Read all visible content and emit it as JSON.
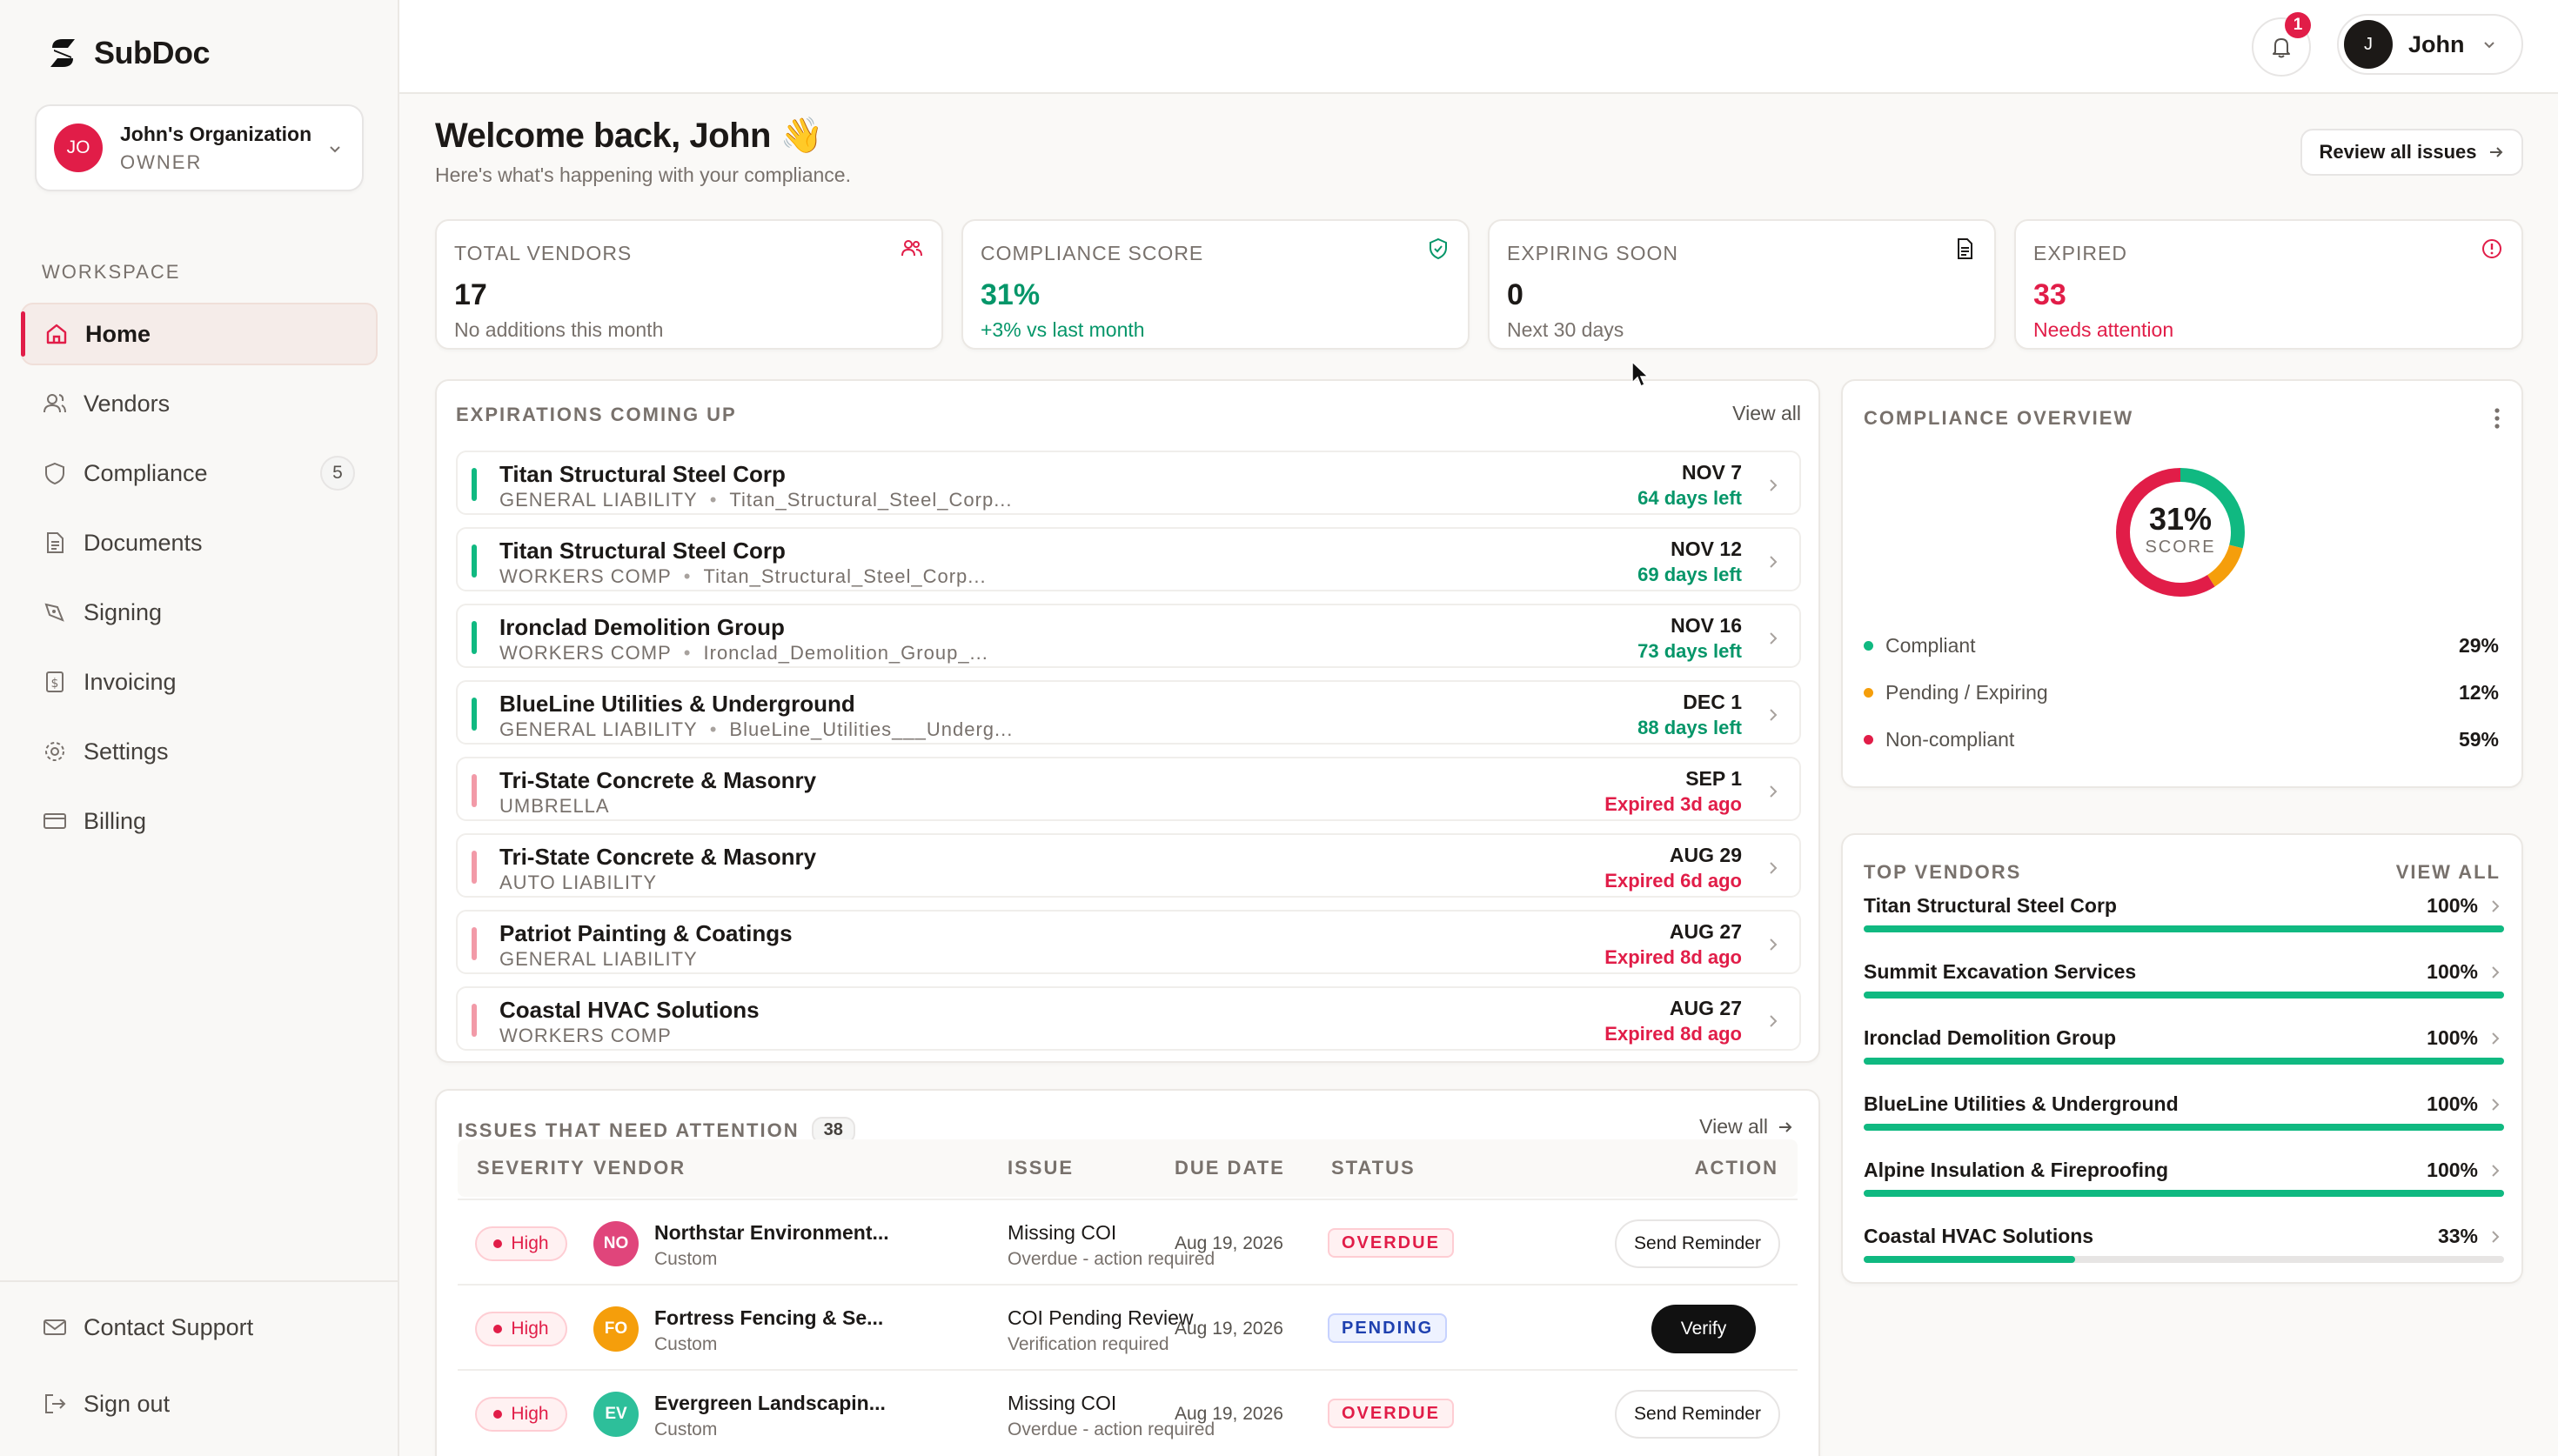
{
  "brand": {
    "name": "SubDoc"
  },
  "org": {
    "initials": "JO",
    "name": "John's Organization",
    "role": "OWNER"
  },
  "sidebar": {
    "section_label": "WORKSPACE",
    "items": [
      {
        "label": "Home"
      },
      {
        "label": "Vendors"
      },
      {
        "label": "Compliance",
        "badge": "5"
      },
      {
        "label": "Documents"
      },
      {
        "label": "Signing"
      },
      {
        "label": "Invoicing"
      },
      {
        "label": "Settings"
      },
      {
        "label": "Billing"
      }
    ],
    "bottom": [
      {
        "label": "Contact Support"
      },
      {
        "label": "Sign out"
      }
    ]
  },
  "topbar": {
    "notification_count": "1",
    "user_initial": "J",
    "user_name": "John"
  },
  "header": {
    "title": "Welcome back, John 👋",
    "subtitle": "Here's what's happening with your compliance.",
    "review_button": "Review all issues"
  },
  "stats": [
    {
      "label": "TOTAL VENDORS",
      "value": "17",
      "sub": "No additions this month"
    },
    {
      "label": "COMPLIANCE SCORE",
      "value": "31%",
      "sub": "+3% vs last month"
    },
    {
      "label": "EXPIRING SOON",
      "value": "0",
      "sub": "Next 30 days"
    },
    {
      "label": "EXPIRED",
      "value": "33",
      "sub": "Needs attention"
    }
  ],
  "expirations": {
    "title": "EXPIRATIONS COMING UP",
    "view_all": "View all",
    "rows": [
      {
        "vendor": "Titan Structural Steel Corp",
        "type": "GENERAL LIABILITY",
        "file": "Titan_Structural_Steel_Corp...",
        "date": "NOV 7",
        "remaining": "64 days left",
        "state": "ok"
      },
      {
        "vendor": "Titan Structural Steel Corp",
        "type": "WORKERS COMP",
        "file": "Titan_Structural_Steel_Corp...",
        "date": "NOV 12",
        "remaining": "69 days left",
        "state": "ok"
      },
      {
        "vendor": "Ironclad Demolition Group",
        "type": "WORKERS COMP",
        "file": "Ironclad_Demolition_Group_...",
        "date": "NOV 16",
        "remaining": "73 days left",
        "state": "ok"
      },
      {
        "vendor": "BlueLine Utilities & Underground",
        "type": "GENERAL LIABILITY",
        "file": "BlueLine_Utilities___Underg...",
        "date": "DEC 1",
        "remaining": "88 days left",
        "state": "ok"
      },
      {
        "vendor": "Tri-State Concrete & Masonry",
        "type": "UMBRELLA",
        "file": "",
        "date": "SEP 1",
        "remaining": "Expired 3d ago",
        "state": "expired"
      },
      {
        "vendor": "Tri-State Concrete & Masonry",
        "type": "AUTO LIABILITY",
        "file": "",
        "date": "AUG 29",
        "remaining": "Expired 6d ago",
        "state": "expired"
      },
      {
        "vendor": "Patriot Painting & Coatings",
        "type": "GENERAL LIABILITY",
        "file": "",
        "date": "AUG 27",
        "remaining": "Expired 8d ago",
        "state": "expired"
      },
      {
        "vendor": "Coastal HVAC Solutions",
        "type": "WORKERS COMP",
        "file": "",
        "date": "AUG 27",
        "remaining": "Expired 8d ago",
        "state": "expired"
      }
    ]
  },
  "issues": {
    "title": "ISSUES THAT NEED ATTENTION",
    "count": "38",
    "view_all": "View all",
    "columns": [
      "SEVERITY",
      "VENDOR",
      "ISSUE",
      "DUE DATE",
      "STATUS",
      "ACTION"
    ],
    "rows": [
      {
        "severity": "High",
        "initials": "NO",
        "avatar_color": "#e0457b",
        "vendor": "Northstar Environment...",
        "vendor_type": "Custom",
        "issue": "Missing COI",
        "issue_sub": "Overdue - action required",
        "due": "Aug 19, 2026",
        "status": "OVERDUE",
        "status_kind": "overdue",
        "action": "Send Reminder",
        "action_kind": "outline"
      },
      {
        "severity": "High",
        "initials": "FO",
        "avatar_color": "#f59e0b",
        "vendor": "Fortress Fencing & Se...",
        "vendor_type": "Custom",
        "issue": "COI Pending Review",
        "issue_sub": "Verification required",
        "due": "Aug 19, 2026",
        "status": "PENDING",
        "status_kind": "pending",
        "action": "Verify",
        "action_kind": "dark"
      },
      {
        "severity": "High",
        "initials": "EV",
        "avatar_color": "#2dbf9a",
        "vendor": "Evergreen Landscapin...",
        "vendor_type": "Custom",
        "issue": "Missing COI",
        "issue_sub": "Overdue - action required",
        "due": "Aug 19, 2026",
        "status": "OVERDUE",
        "status_kind": "overdue",
        "action": "Send Reminder",
        "action_kind": "outline"
      }
    ]
  },
  "overview": {
    "title": "COMPLIANCE OVERVIEW",
    "score": "31%",
    "score_label": "SCORE",
    "legend": [
      {
        "label": "Compliant",
        "pct": "29%",
        "color": "#10b981",
        "value": 29
      },
      {
        "label": "Pending / Expiring",
        "pct": "12%",
        "color": "#f59e0b",
        "value": 12
      },
      {
        "label": "Non-compliant",
        "pct": "59%",
        "color": "#e11d48",
        "value": 59
      }
    ]
  },
  "top_vendors": {
    "title": "TOP VENDORS",
    "view_all": "VIEW ALL",
    "rows": [
      {
        "name": "Titan Structural Steel Corp",
        "pct": "100%",
        "value": 100
      },
      {
        "name": "Summit Excavation Services",
        "pct": "100%",
        "value": 100
      },
      {
        "name": "Ironclad Demolition Group",
        "pct": "100%",
        "value": 100
      },
      {
        "name": "BlueLine Utilities & Underground",
        "pct": "100%",
        "value": 100
      },
      {
        "name": "Alpine Insulation & Fireproofing",
        "pct": "100%",
        "value": 100
      },
      {
        "name": "Coastal HVAC Solutions",
        "pct": "33%",
        "value": 33
      }
    ]
  },
  "colors": {
    "accent": "#e11d48",
    "success": "#10b981",
    "warning": "#f59e0b",
    "positive_text": "#059669",
    "ok_bar": "#10b981",
    "expired_bar": "#f29aa8"
  }
}
